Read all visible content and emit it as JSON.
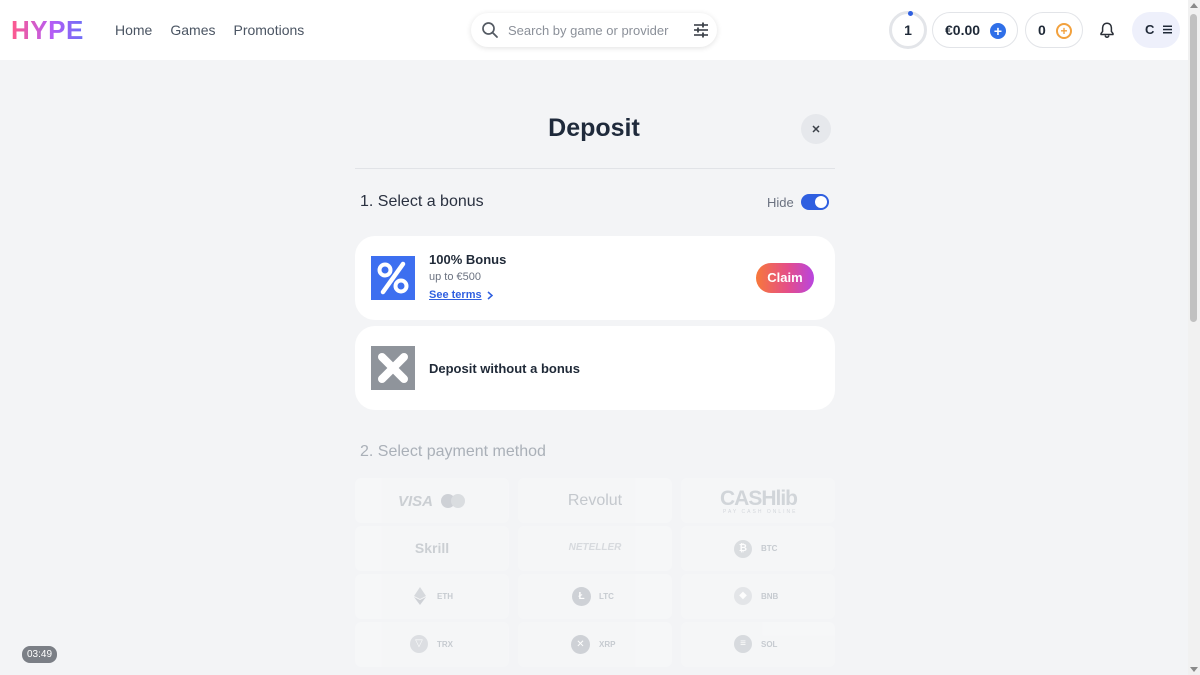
{
  "header": {
    "logo": "HYPE",
    "nav": [
      {
        "label": "Home"
      },
      {
        "label": "Games"
      },
      {
        "label": "Promotions"
      }
    ],
    "search": {
      "placeholder": "Search by game or provider"
    },
    "level": "1",
    "balance": "€0.00",
    "coins": "0",
    "avatar_initial": "C"
  },
  "modal": {
    "title": "Deposit",
    "section1": "1. Select a bonus",
    "hide_label": "Hide",
    "hide_toggle_on": true,
    "bonus": {
      "name": "100% Bonus",
      "subtitle": "up to €500",
      "terms_link": "See terms",
      "claim_label": "Claim"
    },
    "no_bonus_label": "Deposit without a bonus",
    "section2": "2. Select payment method",
    "payment_methods": [
      {
        "name": "VISA",
        "icon": "visa-mastercard-logo"
      },
      {
        "name": "Revolut",
        "icon": "revolut-logo"
      },
      {
        "name": "CASHlib",
        "sub": "PAY CASH ONLINE",
        "icon": "cashlib-logo"
      },
      {
        "name": "Skrill",
        "icon": "skrill-logo"
      },
      {
        "name": "NETELLER",
        "icon": "neteller-logo"
      },
      {
        "name": "BTC",
        "icon": "bitcoin-icon"
      },
      {
        "name": "ETH",
        "icon": "ethereum-icon"
      },
      {
        "name": "LTC",
        "icon": "litecoin-icon"
      },
      {
        "name": "BNB",
        "icon": "bnb-icon"
      },
      {
        "name": "TRX",
        "icon": "tron-icon"
      },
      {
        "name": "XRP",
        "icon": "xrp-icon"
      },
      {
        "name": "SOL",
        "icon": "solana-icon"
      }
    ]
  },
  "timer": "03:49",
  "colors": {
    "accent": "#2f5fe0",
    "background": "#f3f4f6",
    "claim_gradient": [
      "#f7783a",
      "#e44d8a",
      "#b845e0"
    ]
  }
}
